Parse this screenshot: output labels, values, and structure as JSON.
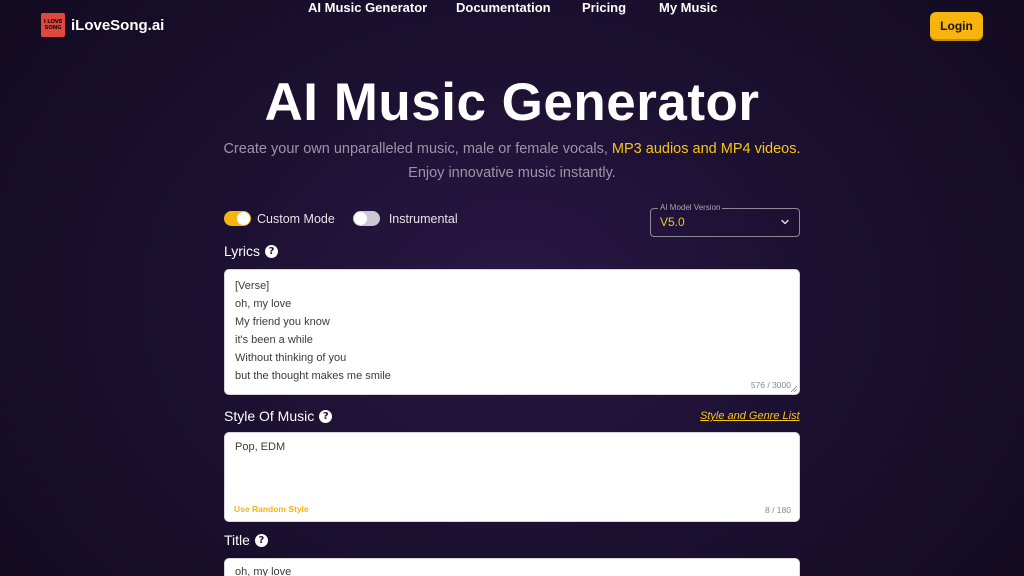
{
  "brand": {
    "logo_line1": "I LOVE",
    "logo_line2": "SONG",
    "name": "iLoveSong.ai"
  },
  "nav": {
    "links": [
      "AI Music Generator",
      "Documentation",
      "Pricing",
      "My Music"
    ],
    "login_label": "Login"
  },
  "hero": {
    "title": "AI Music Generator",
    "subtitle_plain": "Create your own unparalleled music, male or female vocals, ",
    "subtitle_highlight": "MP3 audios and MP4 videos.",
    "subtitle_line2": "Enjoy innovative music instantly."
  },
  "options": {
    "custom_mode_label": "Custom Mode",
    "custom_mode_on": true,
    "instrumental_label": "Instrumental",
    "instrumental_on": false
  },
  "model": {
    "legend": "AI Model Version",
    "value": "V5.0"
  },
  "lyrics": {
    "label": "Lyrics",
    "value": "[Verse]\noh, my love\nMy friend you know\nit's been a while\nWithout thinking of you\nbut the thought makes me smile",
    "counter": "576 / 3000"
  },
  "style": {
    "label": "Style Of Music",
    "value": "Pop, EDM",
    "genre_link": "Style and Genre List",
    "random_label": "Use Random Style",
    "counter": "8 / 180"
  },
  "title_field": {
    "label": "Title",
    "value": "oh, my love"
  },
  "colors": {
    "accent": "#f6b40e",
    "highlight_text": "#f6c517",
    "background": "#1d1133"
  }
}
